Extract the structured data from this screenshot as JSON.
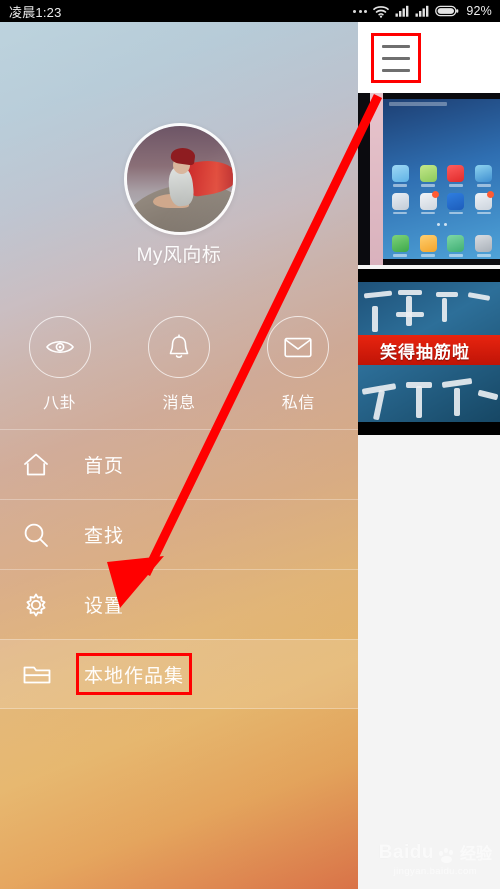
{
  "status_bar": {
    "time": "凌晨1:23",
    "battery_percent": "92%",
    "icons": [
      "more-dots-icon",
      "wifi-icon",
      "signal-icon",
      "signal-icon",
      "battery-icon"
    ]
  },
  "drawer": {
    "profile": {
      "avatar_alt": "red-cape-figure-on-rock",
      "username": "My风向标"
    },
    "quick_actions": [
      {
        "icon": "eye-icon",
        "label": "八卦"
      },
      {
        "icon": "bell-icon",
        "label": "消息"
      },
      {
        "icon": "envelope-icon",
        "label": "私信"
      }
    ],
    "menu_items": [
      {
        "icon": "home-icon",
        "label": "首页",
        "active": false,
        "highlighted": false
      },
      {
        "icon": "search-icon",
        "label": "查找",
        "active": false,
        "highlighted": false
      },
      {
        "icon": "gear-icon",
        "label": "设置",
        "active": false,
        "highlighted": false
      },
      {
        "icon": "folder-icon",
        "label": "本地作品集",
        "active": true,
        "highlighted": true
      }
    ]
  },
  "right_panel": {
    "menu_button": {
      "icon": "hamburger-menu-icon",
      "highlighted": true
    },
    "thumbnails": [
      {
        "name": "phone-home-screen-photo",
        "caption": ""
      },
      {
        "name": "calligraphy-video-thumbnail",
        "caption": "笑得抽筋啦"
      }
    ]
  },
  "annotations": {
    "arrow_color": "#ff0000",
    "highlight_box_color": "#ff0000",
    "arrow_from": "hamburger-menu-icon",
    "arrow_to": "本地作品集"
  },
  "watermark": {
    "brand": "Baidu",
    "brand_cn": "经验",
    "url": "jingyan.baidu.com"
  },
  "colors": {
    "accent_red": "#ff0000",
    "drawer_top": "#b9d1dc",
    "drawer_bottom": "#e0764a",
    "panel_bg": "#f4f4f4",
    "statusbar_bg": "#000000"
  }
}
